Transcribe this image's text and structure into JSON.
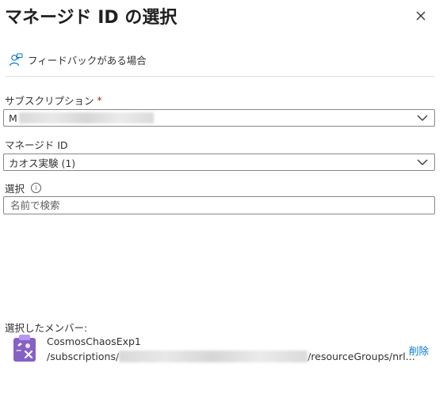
{
  "header": {
    "title": "マネージド ID の選択",
    "close_icon": "close-icon"
  },
  "feedback": {
    "label": "フィードバックがある場合",
    "icon": "feedback-person-icon"
  },
  "subscription": {
    "label": "サブスクリプション",
    "required_mark": "*",
    "value_prefix": "M",
    "icon": "chevron-down-icon"
  },
  "managed_id": {
    "label": "マネージド ID",
    "value": "カオス実験 (1)",
    "icon": "chevron-down-icon"
  },
  "select": {
    "label": "選択",
    "info_icon": "info-icon",
    "info_glyph": "i",
    "placeholder": "名前で検索"
  },
  "selected_members": {
    "label": "選択したメンバー:",
    "items": [
      {
        "name": "CosmosChaosExp1",
        "path_prefix": "/subscriptions/",
        "path_suffix": "/resourceGroups/nrl...",
        "remove_label": "削除",
        "icon": "managed-identity-icon"
      }
    ]
  },
  "colors": {
    "accent": "#0078d4",
    "required": "#a4262c",
    "border": "#8a8886",
    "icon_purple": "#8661c5"
  }
}
